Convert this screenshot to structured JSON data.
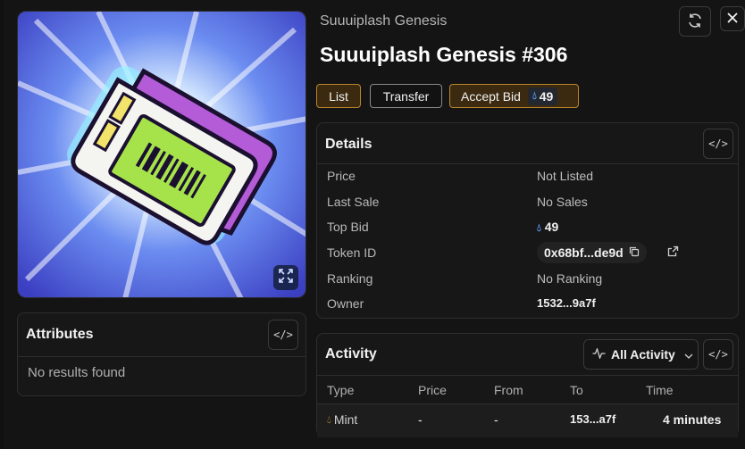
{
  "header": {
    "collection": "Suuuiplash Genesis",
    "title": "Suuuiplash Genesis #306",
    "refresh_icon": "refresh-icon",
    "close_icon": "close-icon"
  },
  "actions": {
    "list_label": "List",
    "transfer_label": "Transfer",
    "accept_bid_label": "Accept Bid",
    "accept_bid_value": "49"
  },
  "details": {
    "title": "Details",
    "rows": [
      {
        "label": "Price",
        "value": "Not Listed"
      },
      {
        "label": "Last Sale",
        "value": "No Sales"
      },
      {
        "label": "Top Bid",
        "value": "49"
      },
      {
        "label": "Token ID",
        "value": "0x68bf...de9d"
      },
      {
        "label": "Ranking",
        "value": "No Ranking"
      },
      {
        "label": "Owner",
        "value": "1532...9a7f"
      }
    ]
  },
  "attributes": {
    "title": "Attributes",
    "empty_text": "No results found"
  },
  "activity": {
    "title": "Activity",
    "filter_label": "All Activity",
    "columns": [
      "Type",
      "Price",
      "From",
      "To",
      "Time"
    ],
    "rows": [
      {
        "type": "Mint",
        "price": "-",
        "from": "-",
        "to": "153...a7f",
        "time": "4 minutes"
      }
    ]
  },
  "colors": {
    "accent_gold": "#b8862c",
    "sui_blue": "#5b9cf5",
    "mint_orange": "#e8a13a",
    "background": "#141414"
  }
}
